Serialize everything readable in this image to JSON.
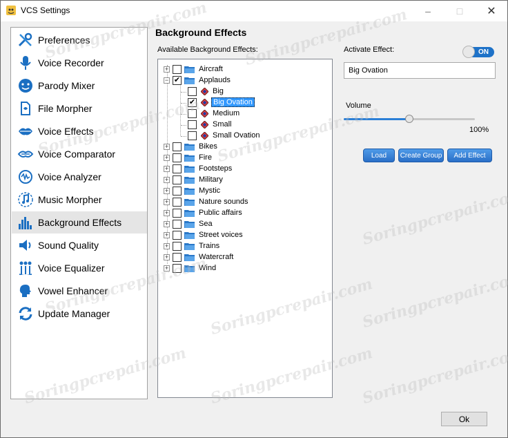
{
  "window": {
    "title": "VCS Settings",
    "app_icon": "vcs-app-icon"
  },
  "window_controls": {
    "minimize": "–",
    "maximize": "□",
    "close": "✕"
  },
  "sidebar": {
    "items": [
      {
        "label": "Preferences",
        "icon": "wrench-screwdriver-icon"
      },
      {
        "label": "Voice Recorder",
        "icon": "microphone-icon"
      },
      {
        "label": "Parody Mixer",
        "icon": "smiley-face-icon"
      },
      {
        "label": "File Morpher",
        "icon": "file-morph-icon"
      },
      {
        "label": "Voice Effects",
        "icon": "lips-icon"
      },
      {
        "label": "Voice Comparator",
        "icon": "voice-compare-icon"
      },
      {
        "label": "Voice Analyzer",
        "icon": "waveform-analyzer-icon"
      },
      {
        "label": "Music Morpher",
        "icon": "music-note-icon"
      },
      {
        "label": "Background Effects",
        "icon": "equalizer-bars-icon"
      },
      {
        "label": "Sound Quality",
        "icon": "speaker-icon"
      },
      {
        "label": "Voice Equalizer",
        "icon": "equalizer-faces-icon"
      },
      {
        "label": "Vowel Enhancer",
        "icon": "speaking-head-icon"
      },
      {
        "label": "Update Manager",
        "icon": "update-arrows-icon"
      }
    ],
    "selected": "Background Effects"
  },
  "panel": {
    "title": "Background Effects",
    "available_label": "Available Background Effects:",
    "tree": [
      {
        "label": "Aircraft",
        "expanded": false,
        "checked": false,
        "children": []
      },
      {
        "label": "Applauds",
        "expanded": true,
        "checked": true,
        "children": [
          {
            "label": "Big",
            "checked": false
          },
          {
            "label": "Big Ovation",
            "checked": true,
            "selected": true
          },
          {
            "label": "Medium",
            "checked": false
          },
          {
            "label": "Small",
            "checked": false
          },
          {
            "label": "Small Ovation",
            "checked": false
          }
        ]
      },
      {
        "label": "Bikes",
        "expanded": false,
        "checked": false,
        "children": []
      },
      {
        "label": "Fire",
        "expanded": false,
        "checked": false,
        "children": []
      },
      {
        "label": "Footsteps",
        "expanded": false,
        "checked": false,
        "children": []
      },
      {
        "label": "Military",
        "expanded": false,
        "checked": false,
        "children": []
      },
      {
        "label": "Mystic",
        "expanded": false,
        "checked": false,
        "children": []
      },
      {
        "label": "Nature sounds",
        "expanded": false,
        "checked": false,
        "children": []
      },
      {
        "label": "Public affairs",
        "expanded": false,
        "checked": false,
        "children": []
      },
      {
        "label": "Sea",
        "expanded": false,
        "checked": false,
        "children": []
      },
      {
        "label": "Street voices",
        "expanded": false,
        "checked": false,
        "children": []
      },
      {
        "label": "Trains",
        "expanded": false,
        "checked": false,
        "children": []
      },
      {
        "label": "Watercraft",
        "expanded": false,
        "checked": false,
        "children": []
      },
      {
        "label": "Wind",
        "expanded": false,
        "checked": false,
        "children": []
      }
    ],
    "activate_label": "Activate Effect:",
    "toggle_text": "ON",
    "active_effect": "Big Ovation",
    "volume_label": "Volume",
    "volume_percent": 50,
    "volume_value_text": "100%",
    "buttons": {
      "load": "Load",
      "create_group": "Create Group",
      "add_effect": "Add Effect"
    },
    "ok": "Ok"
  },
  "watermark": "Soringpcrepair.com",
  "colors": {
    "accent": "#2b7fd6",
    "selection": "#3399ff",
    "toggle_on": "#1e72c8",
    "sidebar_selected": "#e5e5e5"
  }
}
